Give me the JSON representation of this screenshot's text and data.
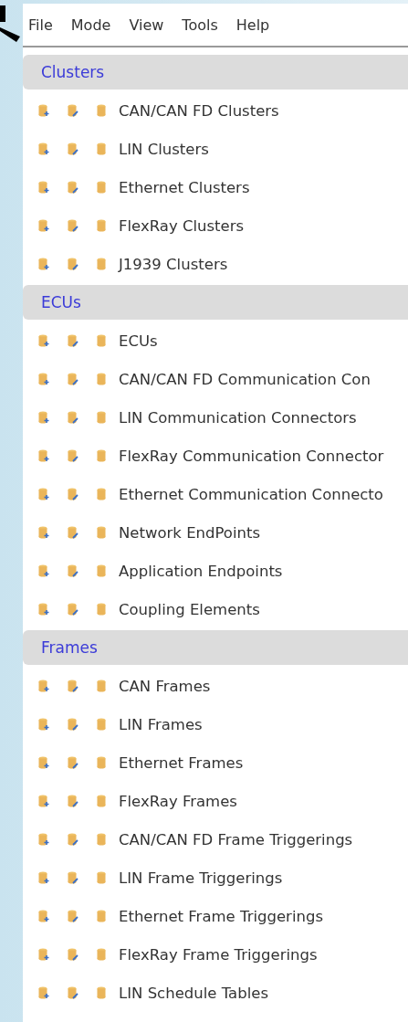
{
  "menu": [
    "File",
    "Mode",
    "View",
    "Tools",
    "Help"
  ],
  "sections": [
    {
      "title": "Clusters",
      "items": [
        "CAN/CAN FD Clusters",
        "LIN Clusters",
        "Ethernet Clusters",
        "FlexRay Clusters",
        "J1939 Clusters"
      ]
    },
    {
      "title": "ECUs",
      "items": [
        "ECUs",
        "CAN/CAN FD Communication Con",
        "LIN Communication Connectors",
        "FlexRay Communication Connector",
        "Ethernet Communication Connecto",
        "Network EndPoints",
        "Application Endpoints",
        "Coupling Elements"
      ]
    },
    {
      "title": "Frames",
      "items": [
        "CAN Frames",
        "LIN Frames",
        "Ethernet Frames",
        "FlexRay Frames",
        "CAN/CAN FD Frame Triggerings",
        "LIN Frame Triggerings",
        "Ethernet Frame Triggerings",
        "FlexRay Frame Triggerings",
        "LIN Schedule Tables"
      ]
    }
  ]
}
